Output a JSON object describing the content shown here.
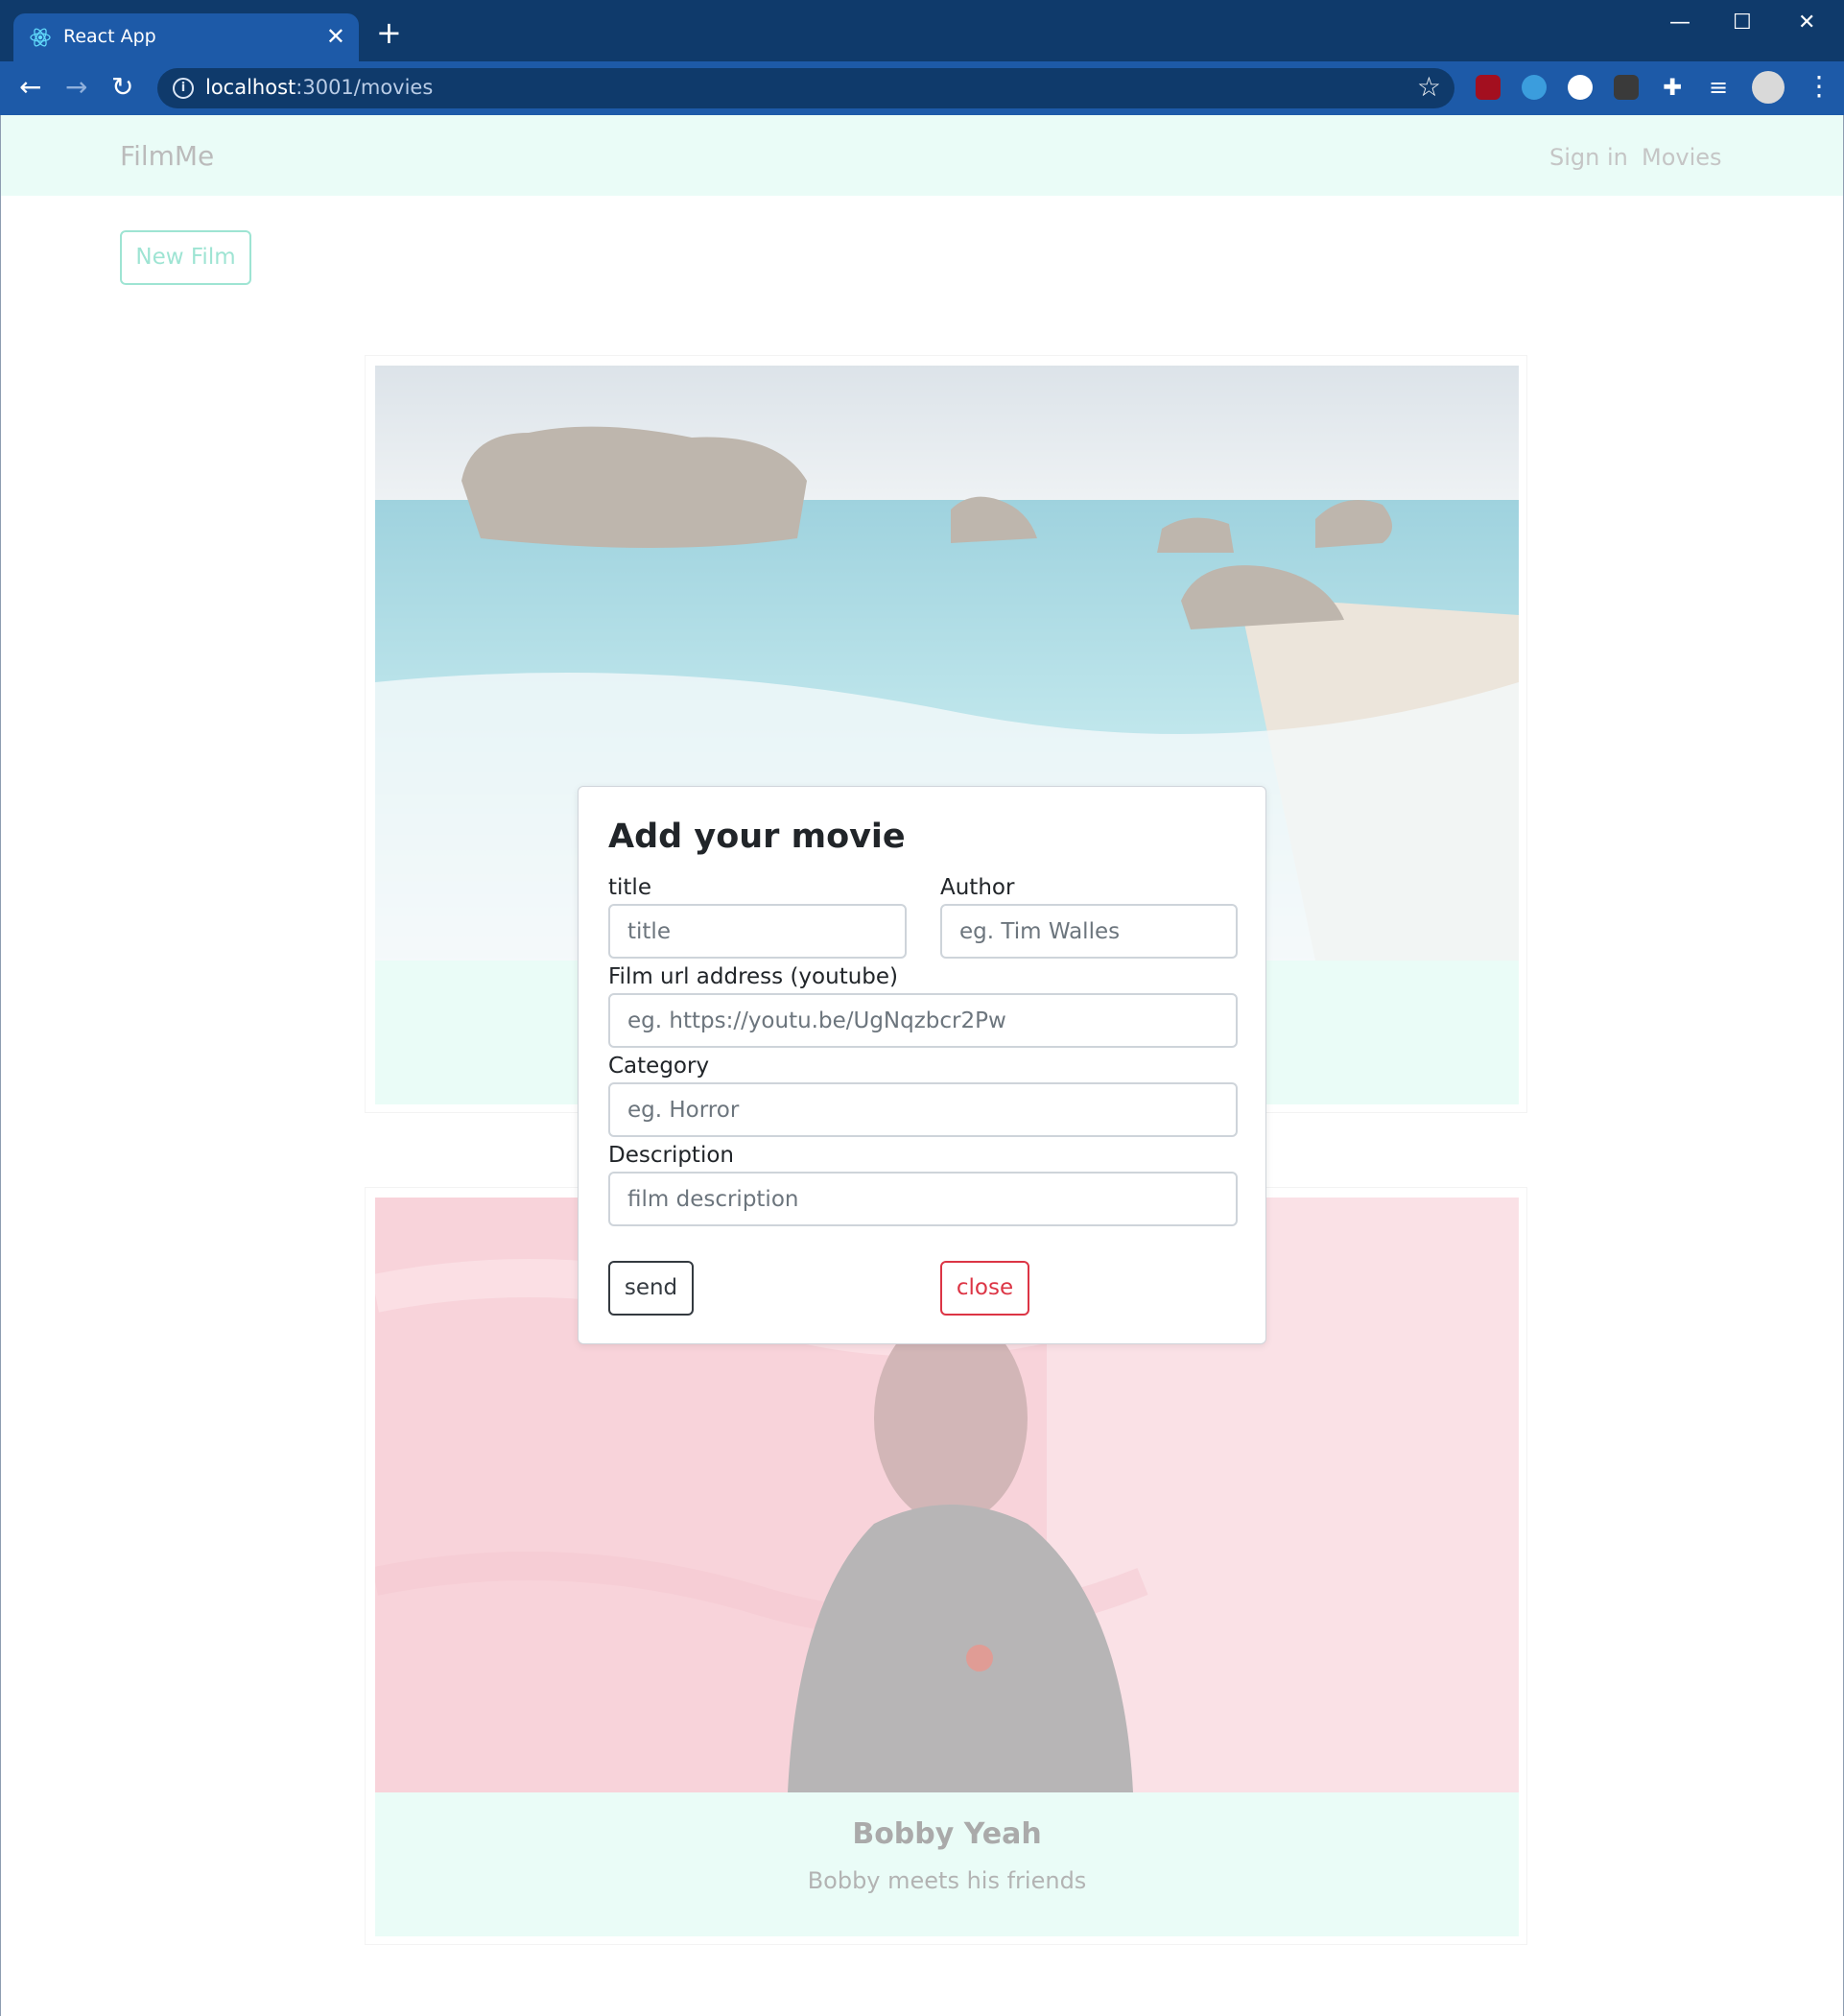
{
  "browser": {
    "tab_title": "React App",
    "url_host": "localhost",
    "url_path": ":3001/movies"
  },
  "navbar": {
    "brand": "FilmMe",
    "links": [
      "Sign in",
      "Movies"
    ]
  },
  "toolbar": {
    "new_film_label": "New Film"
  },
  "movies": [
    {
      "title": "",
      "description": "",
      "image": "beach-rocks-sea"
    },
    {
      "title": "Bobby Yeah",
      "description": "Bobby meets his friends",
      "image": "pink-fur-puppet"
    }
  ],
  "modal": {
    "heading": "Add your movie",
    "fields": {
      "title": {
        "label": "title",
        "placeholder": "title"
      },
      "author": {
        "label": "Author",
        "placeholder": "eg. Tim Walles"
      },
      "url": {
        "label": "Film url address (youtube)",
        "placeholder": "eg. https://youtu.be/UgNqzbcr2Pw"
      },
      "category": {
        "label": "Category",
        "placeholder": "eg. Horror"
      },
      "description": {
        "label": "Description",
        "placeholder": "film description"
      }
    },
    "send_label": "send",
    "close_label": "close"
  },
  "colors": {
    "navbar_bg": "#d4f9ef",
    "accent_teal": "#3cc9a6",
    "danger": "#dc3545",
    "chrome_dark": "#0f3a6b",
    "chrome_tab": "#1d5aa8"
  }
}
